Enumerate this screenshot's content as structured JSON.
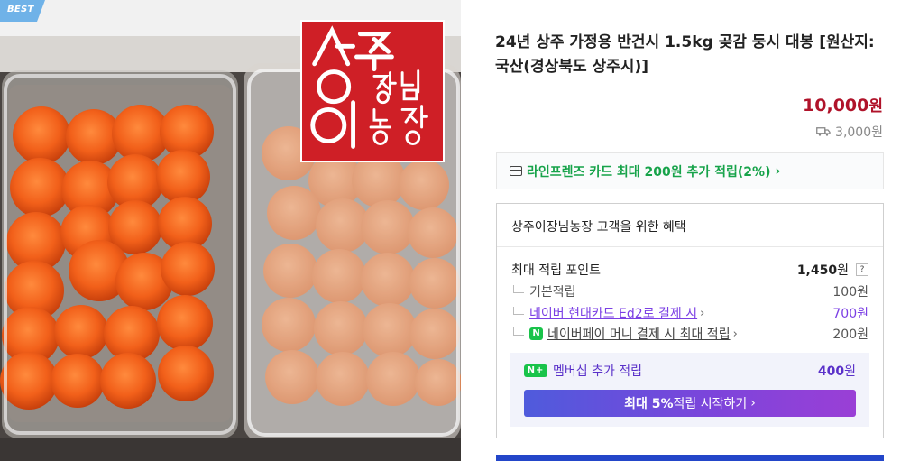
{
  "image": {
    "badge": "BEST",
    "logo_text": "상주이장님농장",
    "alt": "곶감 제품 사진"
  },
  "product": {
    "title": "24년 상주 가정용 반건시 1.5kg 곶감 둥시 대봉 [원산지:국산(경상북도 상주시)]",
    "price_value": "10,000",
    "price_unit": "원",
    "shipping_fee": "3,000원",
    "shipping_icon": "truck-icon"
  },
  "card_promo": {
    "text": "라인프렌즈 카드 최대 200원 추가 적립(2%)",
    "chevron": "›",
    "icon": "card-icon",
    "color": "#17a34a"
  },
  "benefits": {
    "header": "상주이장님농장 고객을 위한 혜택",
    "max_points_label": "최대 적립 포인트",
    "max_points_value": "1,450",
    "max_points_unit": "원",
    "help": "?",
    "rows": [
      {
        "label": "기본적립",
        "amount": "100원"
      },
      {
        "label": "네이버 현대카드 Ed2로 결제 시",
        "amount": "700원"
      },
      {
        "label": "네이버페이 머니 결제 시 최대 적립",
        "amount": "200원"
      }
    ],
    "npay_icon_text": "N",
    "membership": {
      "icon_text": "N+",
      "label": "멤버십 추가 적립",
      "amount_value": "400",
      "amount_unit": "원",
      "button_bold": "최대 5%",
      "button_rest": " 적립 시작하기",
      "button_chevron": "›"
    }
  },
  "colors": {
    "price": "#b0132a",
    "accent_purple": "#7b3fe4",
    "naver_green": "#19c34a",
    "logo_red": "#cf1f26",
    "buy_button": "#2346c9"
  }
}
